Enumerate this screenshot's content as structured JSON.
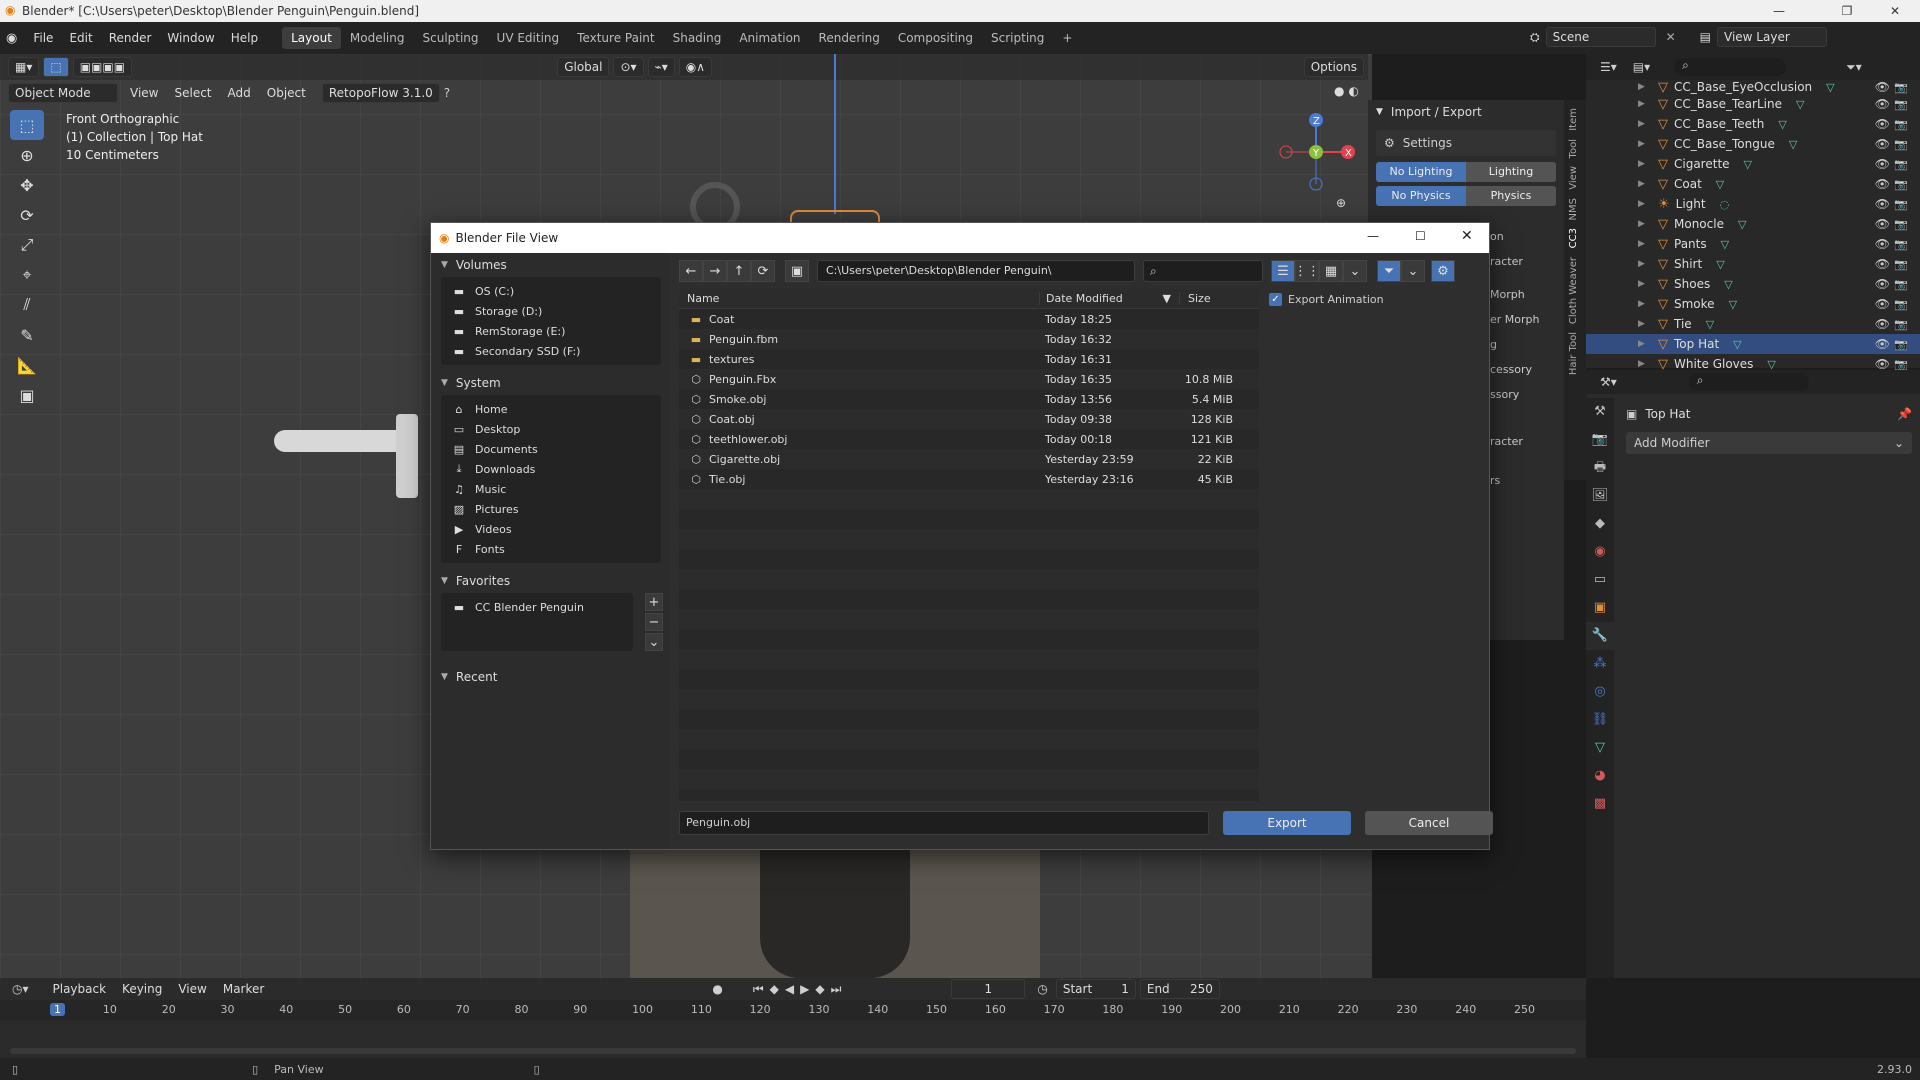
{
  "window": {
    "title": "Blender* [C:\\Users\\peter\\Desktop\\Blender Penguin\\Penguin.blend]"
  },
  "menu": [
    "File",
    "Edit",
    "Render",
    "Window",
    "Help"
  ],
  "workspaces": [
    "Layout",
    "Modeling",
    "Sculpting",
    "UV Editing",
    "Texture Paint",
    "Shading",
    "Animation",
    "Rendering",
    "Compositing",
    "Scripting"
  ],
  "scene": "Scene",
  "view_layer": "View Layer",
  "viewport": {
    "mode": "Object Mode",
    "menus": [
      "View",
      "Select",
      "Add",
      "Object"
    ],
    "addon": "RetopoFlow 3.1.0",
    "transform": "Global",
    "options": "Options",
    "overlay_lines": [
      "Front Orthographic",
      "(1) Collection | Top Hat",
      "10 Centimeters"
    ]
  },
  "npanel": {
    "header": "Import / Export",
    "settings": "Settings",
    "no_lighting": "No Lighting",
    "lighting": "Lighting",
    "no_physics": "No Physics",
    "physics": "Physics",
    "frag": [
      "on",
      "racter",
      "Morph",
      "er Morph",
      "g",
      "cessory",
      "ssory",
      "racter",
      "rs"
    ],
    "tabs": [
      "Item",
      "Tool",
      "View",
      "NMS",
      "CC3",
      "Cloth Weaver",
      "Hair Tool"
    ]
  },
  "outliner": {
    "items": [
      {
        "name": "CC_Base_EyeOcclusion",
        "type": "obj"
      },
      {
        "name": "CC_Base_TearLine",
        "type": "obj"
      },
      {
        "name": "CC_Base_Teeth",
        "type": "obj"
      },
      {
        "name": "CC_Base_Tongue",
        "type": "obj"
      },
      {
        "name": "Cigarette",
        "type": "obj"
      },
      {
        "name": "Coat",
        "type": "obj"
      },
      {
        "name": "Light",
        "type": "light"
      },
      {
        "name": "Monocle",
        "type": "obj"
      },
      {
        "name": "Pants",
        "type": "obj"
      },
      {
        "name": "Shirt",
        "type": "obj"
      },
      {
        "name": "Shoes",
        "type": "obj"
      },
      {
        "name": "Smoke",
        "type": "obj"
      },
      {
        "name": "Tie",
        "type": "obj"
      },
      {
        "name": "Top Hat",
        "type": "obj",
        "selected": true
      },
      {
        "name": "White Gloves",
        "type": "obj"
      }
    ]
  },
  "properties": {
    "object": "Top Hat",
    "add_modifier": "Add Modifier"
  },
  "timeline": {
    "menus": [
      "Playback",
      "Keying",
      "View",
      "Marker"
    ],
    "current": "1",
    "start_label": "Start",
    "start": "1",
    "end_label": "End",
    "end": "250",
    "ticks": [
      "1",
      "10",
      "20",
      "30",
      "40",
      "50",
      "60",
      "70",
      "80",
      "90",
      "100",
      "110",
      "120",
      "130",
      "140",
      "150",
      "160",
      "170",
      "180",
      "190",
      "200",
      "210",
      "220",
      "230",
      "240",
      "250"
    ]
  },
  "status": {
    "hint": "Pan View",
    "version": "2.93.0"
  },
  "dialog": {
    "title": "Blender File View",
    "volumes_label": "Volumes",
    "volumes": [
      "OS (C:)",
      "Storage (D:)",
      "RemStorage (E:)",
      "Secondary SSD (F:)"
    ],
    "system_label": "System",
    "system": [
      "Home",
      "Desktop",
      "Documents",
      "Downloads",
      "Music",
      "Pictures",
      "Videos",
      "Fonts"
    ],
    "favorites_label": "Favorites",
    "favorites": [
      "CC Blender Penguin"
    ],
    "recent_label": "Recent",
    "path": "C:\\Users\\peter\\Desktop\\Blender Penguin\\",
    "columns": {
      "name": "Name",
      "date": "Date Modified",
      "size": "Size"
    },
    "files": [
      {
        "name": "Coat",
        "date": "Today 18:25",
        "size": "",
        "kind": "folder"
      },
      {
        "name": "Penguin.fbm",
        "date": "Today 16:32",
        "size": "",
        "kind": "folder"
      },
      {
        "name": "textures",
        "date": "Today 16:31",
        "size": "",
        "kind": "folder"
      },
      {
        "name": "Penguin.Fbx",
        "date": "Today 16:35",
        "size": "10.8 MiB",
        "kind": "file"
      },
      {
        "name": "Smoke.obj",
        "date": "Today 13:56",
        "size": "5.4 MiB",
        "kind": "file"
      },
      {
        "name": "Coat.obj",
        "date": "Today 09:38",
        "size": "128 KiB",
        "kind": "file"
      },
      {
        "name": "teethlower.obj",
        "date": "Today 00:18",
        "size": "121 KiB",
        "kind": "file"
      },
      {
        "name": "Cigarette.obj",
        "date": "Yesterday 23:59",
        "size": "22 KiB",
        "kind": "file"
      },
      {
        "name": "Tie.obj",
        "date": "Yesterday 23:16",
        "size": "45 KiB",
        "kind": "file"
      }
    ],
    "export_animation": "Export Animation",
    "filename": "Penguin.obj",
    "export": "Export",
    "cancel": "Cancel"
  },
  "colors": {
    "accent": "#4772b3",
    "select": "#334d80",
    "object": "#e08d3c",
    "mesh": "#5fc7a5"
  }
}
